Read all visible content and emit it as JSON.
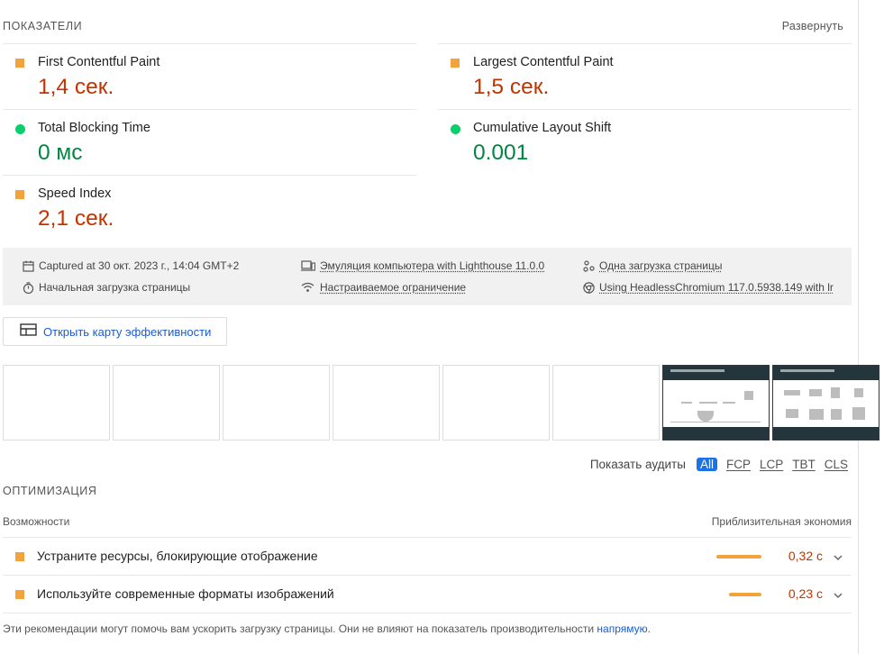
{
  "metrics_section": {
    "title": "ПОКАЗАТЕЛИ",
    "expand_label": "Развернуть",
    "items": [
      {
        "label": "First Contentful Paint",
        "value": "1,4 сек.",
        "rating": "average",
        "color": "#c33300"
      },
      {
        "label": "Largest Contentful Paint",
        "value": "1,5 сек.",
        "rating": "average",
        "color": "#c33300"
      },
      {
        "label": "Total Blocking Time",
        "value": "0 мс",
        "rating": "pass",
        "color": "#018642"
      },
      {
        "label": "Cumulative Layout Shift",
        "value": "0.001",
        "rating": "pass",
        "color": "#018642"
      },
      {
        "label": "Speed Index",
        "value": "2,1 сек.",
        "rating": "average",
        "color": "#c33300"
      }
    ]
  },
  "runtime_info": {
    "captured": "Captured at 30 окт. 2023 г., 14:04 GMT+2",
    "emulation": "Эмуляция компьютера with Lighthouse 11.0.0",
    "single_load": "Одна загрузка страницы",
    "initial_load": "Начальная загрузка страницы",
    "throttling": "Настраиваемое ограничение",
    "browser": "Using HeadlessChromium 117.0.5938.149 with lr"
  },
  "treemap_button": {
    "label": "Открыть карту эффективности",
    "icon": "treemap-icon"
  },
  "filmstrip": {
    "frame_count": 8,
    "loaded_from_frame": 7
  },
  "audit_filter": {
    "label": "Показать аудиты",
    "options": [
      "All",
      "FCP",
      "LCP",
      "TBT",
      "CLS"
    ],
    "selected": "All"
  },
  "optimization": {
    "title": "ОПТИМИЗАЦИЯ",
    "col_left": "Возможности",
    "col_right": "Приблизительная экономия",
    "items": [
      {
        "title": "Устраните ресурсы, блокирующие отображение",
        "savings": "0,32 с",
        "savings_fraction": 1.0
      },
      {
        "title": "Используйте современные форматы изображений",
        "savings": "0,23 с",
        "savings_fraction": 0.72
      }
    ],
    "footnote": "Эти рекомендации могут помочь вам ускорить загрузку страницы. Они не влияют на показатель производительности",
    "footnote_link": "напрямую",
    "footnote_end": "."
  },
  "colors": {
    "average": "#f2a33c",
    "pass": "#0cce6b",
    "accent": "#1a73e8"
  }
}
